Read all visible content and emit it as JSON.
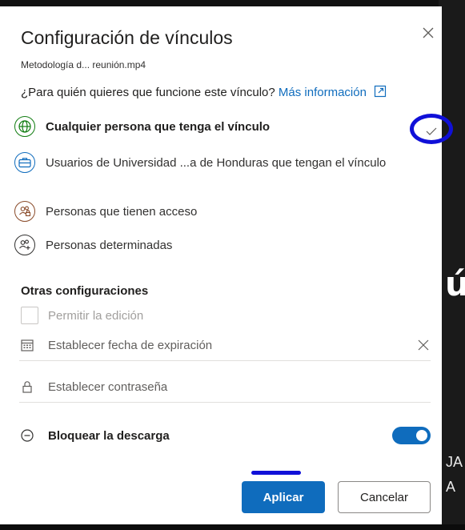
{
  "dialog": {
    "title": "Configuración de vínculos",
    "file_name": "Metodología d... reunión.mp4",
    "question": "¿Para quién quieres que funcione este vínculo?",
    "learn_more": "Más información",
    "close_label": "×"
  },
  "options": [
    {
      "label": "Cualquier persona que tenga el vínculo",
      "icon": "globe-icon",
      "selected": true
    },
    {
      "label": "Usuarios de Universidad ...a de Honduras que tengan el vínculo",
      "icon": "briefcase-icon",
      "selected": false
    },
    {
      "label": "Personas que tienen acceso",
      "icon": "people-lock-icon",
      "selected": false
    },
    {
      "label": "Personas determinadas",
      "icon": "people-add-icon",
      "selected": false
    }
  ],
  "other_settings": {
    "title": "Otras configuraciones",
    "allow_edit_label": "Permitir la edición",
    "allow_edit_checked": false,
    "expiration_placeholder": "Establecer fecha de expiración",
    "password_placeholder": "Establecer contraseña",
    "block_download_label": "Bloquear la descarga",
    "block_download_on": true
  },
  "buttons": {
    "apply": "Aplicar",
    "cancel": "Cancelar"
  },
  "background": {
    "large_glyph": "ú",
    "line1": "JA",
    "line2": "A"
  },
  "colors": {
    "accent": "#0f6cbd",
    "annotation": "#1010d8",
    "option_selected_icon": "#107c10",
    "option_org_icon": "#0f6cbd",
    "option_people_icon": "#8a4b2a"
  }
}
